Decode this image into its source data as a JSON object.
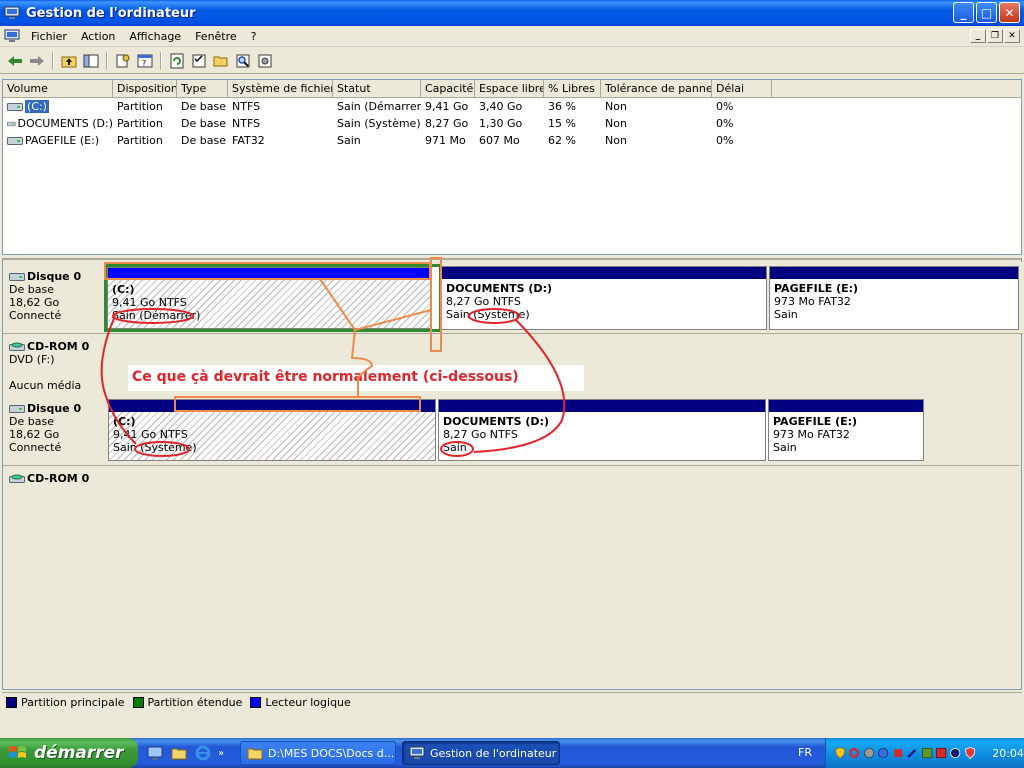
{
  "window": {
    "title": "Gestion de l'ordinateur",
    "buttons": {
      "minimize": "_",
      "maximize": "□",
      "close": "✕"
    }
  },
  "menu": [
    "Fichier",
    "Action",
    "Affichage",
    "Fenêtre",
    "?"
  ],
  "volume_table": {
    "columns": [
      "Volume",
      "Disposition",
      "Type",
      "Système de fichiers",
      "Statut",
      "Capacité",
      "Espace libre",
      "% Libres",
      "Tolérance de pannes",
      "Délai"
    ],
    "rows": [
      [
        "(C:)",
        "Partition",
        "De base",
        "NTFS",
        "Sain (Démarrer)",
        "9,41 Go",
        "3,40 Go",
        "36 %",
        "Non",
        "0%"
      ],
      [
        "DOCUMENTS (D:)",
        "Partition",
        "De base",
        "NTFS",
        "Sain (Système)",
        "8,27 Go",
        "1,30 Go",
        "15 %",
        "Non",
        "0%"
      ],
      [
        "PAGEFILE (E:)",
        "Partition",
        "De base",
        "FAT32",
        "Sain",
        "971 Mo",
        "607 Mo",
        "62 %",
        "Non",
        "0%"
      ]
    ]
  },
  "disks": {
    "disk0": {
      "name": "Disque 0",
      "type": "De base",
      "size": "18,62 Go",
      "state": "Connecté"
    },
    "cdrom0": {
      "name": "CD-ROM 0",
      "drive": "DVD (F:)",
      "media": "Aucun média"
    },
    "partitions": [
      {
        "name": "(C:)",
        "size": "9,41 Go NTFS",
        "status": "Sain (Démarrer)"
      },
      {
        "name": "DOCUMENTS  (D:)",
        "size": "8,27 Go NTFS",
        "status": "Sain (Système)"
      },
      {
        "name": "PAGEFILE  (E:)",
        "size": "973 Mo FAT32",
        "status": "Sain"
      }
    ],
    "disk0_expected": {
      "name": "Disque 0",
      "type": "De base",
      "size": "18,62 Go",
      "state": "Connecté"
    },
    "partitions_expected": [
      {
        "name": "(C:)",
        "size": "9,41 Go NTFS",
        "status": "Sain (Système)"
      },
      {
        "name": "DOCUMENTS  (D:)",
        "size": "8,27 Go NTFS",
        "status": "Sain"
      },
      {
        "name": "PAGEFILE  (E:)",
        "size": "973 Mo FAT32",
        "status": "Sain"
      }
    ],
    "cdrom0_second": {
      "name": "CD-ROM 0",
      "drive": "DVD (F:)"
    }
  },
  "annotation": "Ce que çà devrait être normalement (ci-dessous)",
  "legend": [
    {
      "label": "Partition principale",
      "color": "#000080"
    },
    {
      "label": "Partition étendue",
      "color": "#008000"
    },
    {
      "label": "Lecteur logique",
      "color": "#0000FF"
    }
  ],
  "colors": {
    "annotation_red": "#E3242B",
    "annotation_orange": "#F08A4B",
    "primary_bar": "#000080",
    "extended": "#2E8B2E",
    "logical": "#0000FF"
  },
  "taskbar": {
    "start": "démarrer",
    "tasks": [
      "D:\\MES DOCS\\Docs d...",
      "Gestion de l'ordinateur"
    ],
    "lang": "FR",
    "clock": "20:04"
  }
}
